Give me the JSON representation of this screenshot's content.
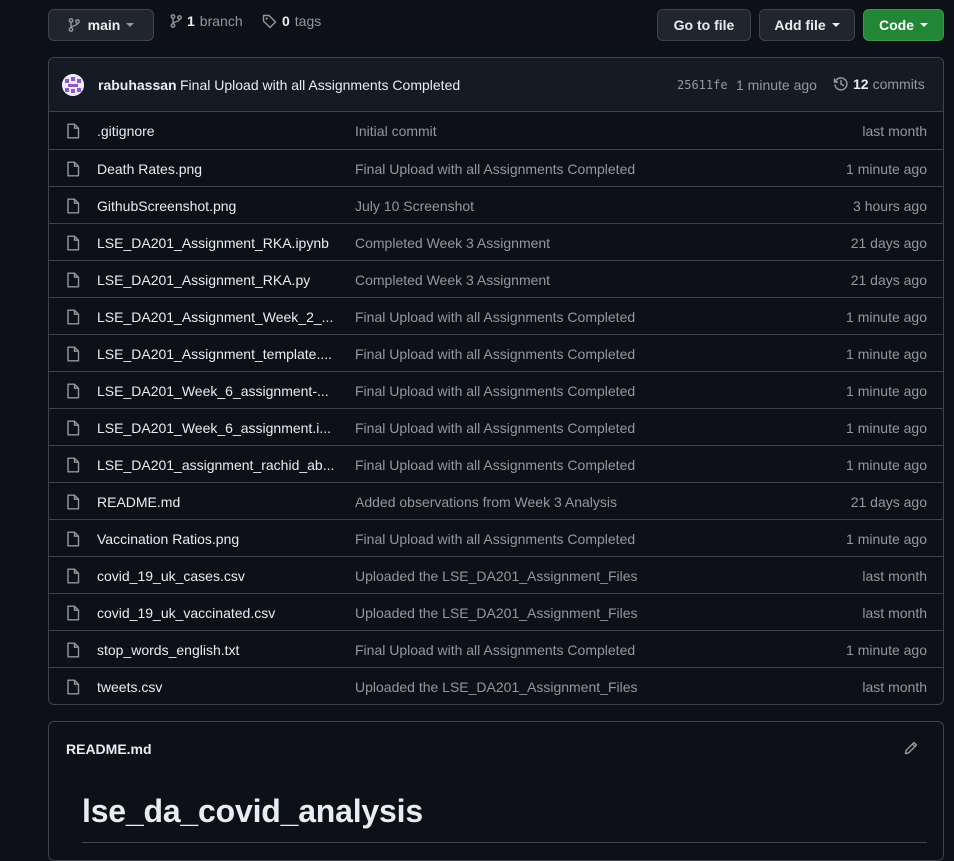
{
  "toolbar": {
    "branch_name": "main",
    "branch_count": "1",
    "branch_label": "branch",
    "tag_count": "0",
    "tag_label": "tags",
    "goto_file_label": "Go to file",
    "add_file_label": "Add file",
    "code_label": "Code"
  },
  "latest_commit": {
    "author": "rabuhassan",
    "message": "Final Upload with all Assignments Completed",
    "sha": "25611fe",
    "time": "1 minute ago",
    "commit_count": "12",
    "commit_label": "commits"
  },
  "files": [
    {
      "name": ".gitignore",
      "message": "Initial commit",
      "age": "last month"
    },
    {
      "name": "Death Rates.png",
      "message": "Final Upload with all Assignments Completed",
      "age": "1 minute ago"
    },
    {
      "name": "GithubScreenshot.png",
      "message": "July 10 Screenshot",
      "age": "3 hours ago"
    },
    {
      "name": "LSE_DA201_Assignment_RKA.ipynb",
      "message": "Completed Week 3 Assignment",
      "age": "21 days ago"
    },
    {
      "name": "LSE_DA201_Assignment_RKA.py",
      "message": "Completed Week 3 Assignment",
      "age": "21 days ago"
    },
    {
      "name": "LSE_DA201_Assignment_Week_2_...",
      "message": "Final Upload with all Assignments Completed",
      "age": "1 minute ago"
    },
    {
      "name": "LSE_DA201_Assignment_template....",
      "message": "Final Upload with all Assignments Completed",
      "age": "1 minute ago"
    },
    {
      "name": "LSE_DA201_Week_6_assignment-...",
      "message": "Final Upload with all Assignments Completed",
      "age": "1 minute ago"
    },
    {
      "name": "LSE_DA201_Week_6_assignment.i...",
      "message": "Final Upload with all Assignments Completed",
      "age": "1 minute ago"
    },
    {
      "name": "LSE_DA201_assignment_rachid_ab...",
      "message": "Final Upload with all Assignments Completed",
      "age": "1 minute ago"
    },
    {
      "name": "README.md",
      "message": "Added observations from Week 3 Analysis",
      "age": "21 days ago"
    },
    {
      "name": "Vaccination Ratios.png",
      "message": "Final Upload with all Assignments Completed",
      "age": "1 minute ago"
    },
    {
      "name": "covid_19_uk_cases.csv",
      "message": "Uploaded the LSE_DA201_Assignment_Files",
      "age": "last month"
    },
    {
      "name": "covid_19_uk_vaccinated.csv",
      "message": "Uploaded the LSE_DA201_Assignment_Files",
      "age": "last month"
    },
    {
      "name": "stop_words_english.txt",
      "message": "Final Upload with all Assignments Completed",
      "age": "1 minute ago"
    },
    {
      "name": "tweets.csv",
      "message": "Uploaded the LSE_DA201_Assignment_Files",
      "age": "last month"
    }
  ],
  "readme": {
    "file_label": "README.md",
    "heading": "lse_da_covid_analysis"
  },
  "colors": {
    "background": "#0d1117",
    "border": "#3d444d",
    "code_button": "#238636",
    "muted_text": "#9198a1"
  }
}
